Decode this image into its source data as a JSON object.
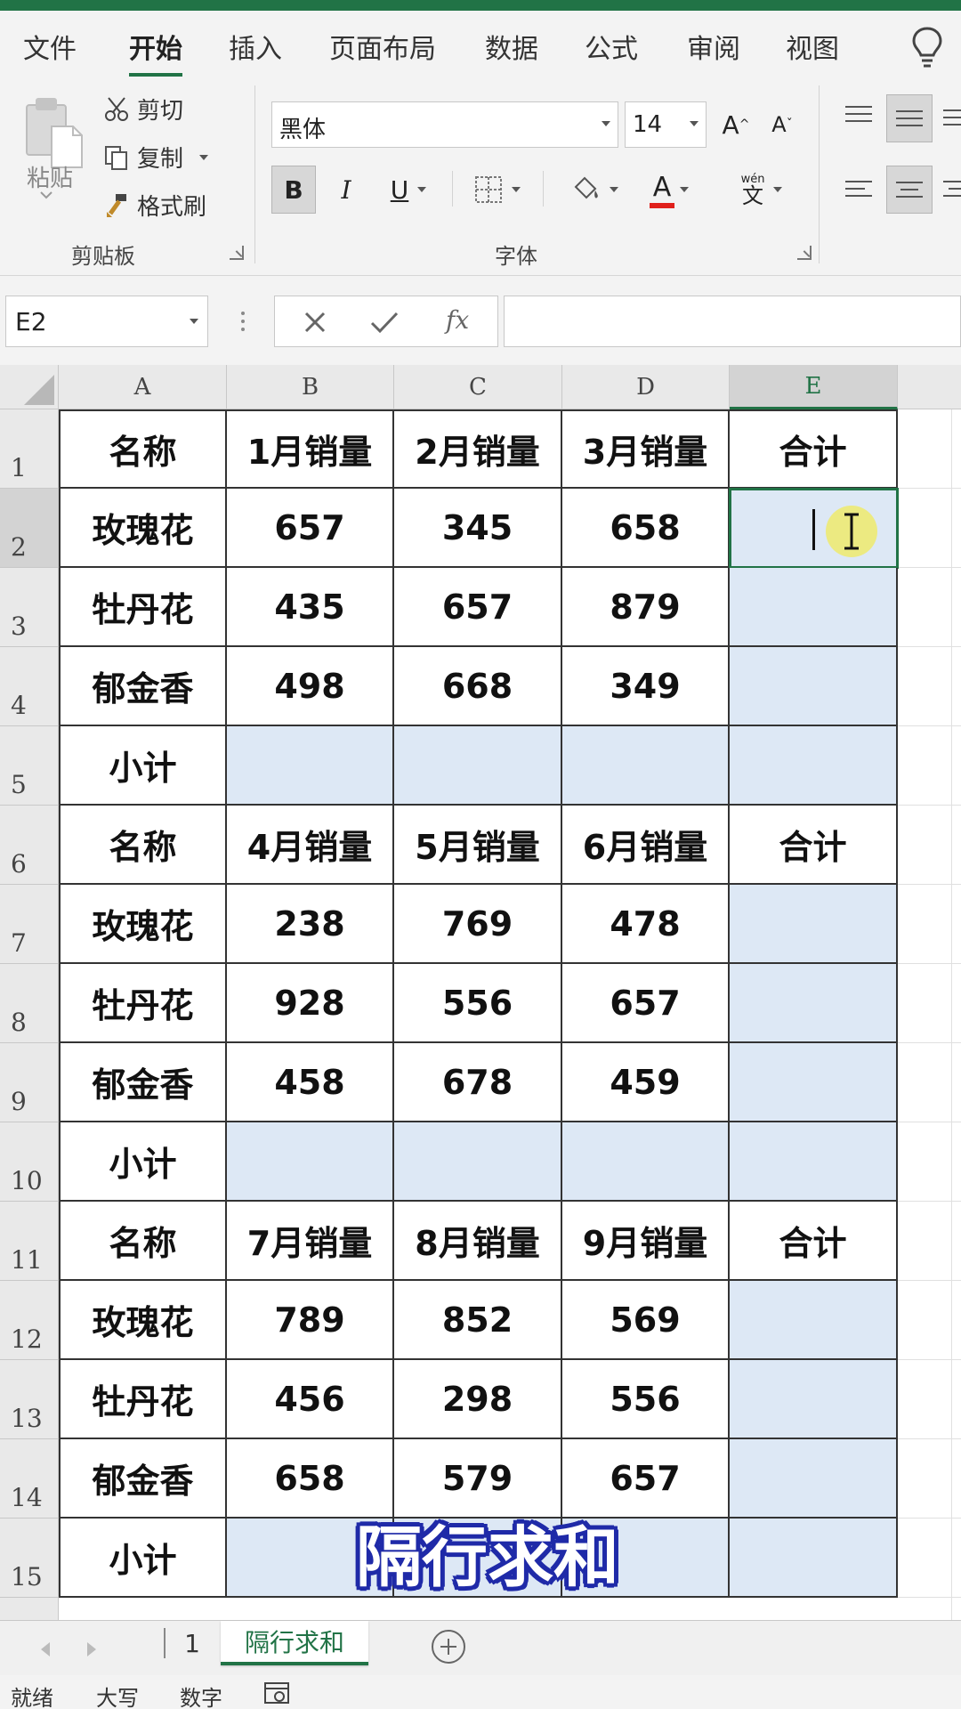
{
  "ribbon_tabs": [
    "文件",
    "开始",
    "插入",
    "页面布局",
    "数据",
    "公式",
    "审阅",
    "视图"
  ],
  "active_tab": "开始",
  "clipboard": {
    "paste_label": "粘贴",
    "cut_label": "剪切",
    "copy_label": "复制",
    "format_painter_label": "格式刷",
    "group_label": "剪贴板"
  },
  "font": {
    "name": "黑体",
    "size": "14",
    "bold": "B",
    "italic": "I",
    "underline": "U",
    "font_color_letter": "A",
    "phonetic_top": "wén",
    "phonetic_char": "文",
    "group_label": "字体",
    "grow_letter": "A",
    "shrink_letter": "A"
  },
  "formula_bar": {
    "name_box": "E2",
    "fx_label": "fx",
    "formula": ""
  },
  "columns": [
    "A",
    "B",
    "C",
    "D",
    "E"
  ],
  "selected_column": "E",
  "selected_row": "2",
  "rows": [
    {
      "num": "1",
      "cells": [
        "名称",
        "1月销量",
        "2月销量",
        "3月销量",
        "合计"
      ],
      "blue": [
        false,
        false,
        false,
        false,
        false
      ]
    },
    {
      "num": "2",
      "cells": [
        "玫瑰花",
        "657",
        "345",
        "658",
        ""
      ],
      "blue": [
        false,
        false,
        false,
        false,
        true
      ]
    },
    {
      "num": "3",
      "cells": [
        "牡丹花",
        "435",
        "657",
        "879",
        ""
      ],
      "blue": [
        false,
        false,
        false,
        false,
        true
      ]
    },
    {
      "num": "4",
      "cells": [
        "郁金香",
        "498",
        "668",
        "349",
        ""
      ],
      "blue": [
        false,
        false,
        false,
        false,
        true
      ]
    },
    {
      "num": "5",
      "cells": [
        "小计",
        "",
        "",
        "",
        ""
      ],
      "blue": [
        false,
        true,
        true,
        true,
        true
      ]
    },
    {
      "num": "6",
      "cells": [
        "名称",
        "4月销量",
        "5月销量",
        "6月销量",
        "合计"
      ],
      "blue": [
        false,
        false,
        false,
        false,
        false
      ]
    },
    {
      "num": "7",
      "cells": [
        "玫瑰花",
        "238",
        "769",
        "478",
        ""
      ],
      "blue": [
        false,
        false,
        false,
        false,
        true
      ]
    },
    {
      "num": "8",
      "cells": [
        "牡丹花",
        "928",
        "556",
        "657",
        ""
      ],
      "blue": [
        false,
        false,
        false,
        false,
        true
      ]
    },
    {
      "num": "9",
      "cells": [
        "郁金香",
        "458",
        "678",
        "459",
        ""
      ],
      "blue": [
        false,
        false,
        false,
        false,
        true
      ]
    },
    {
      "num": "10",
      "cells": [
        "小计",
        "",
        "",
        "",
        ""
      ],
      "blue": [
        false,
        true,
        true,
        true,
        true
      ]
    },
    {
      "num": "11",
      "cells": [
        "名称",
        "7月销量",
        "8月销量",
        "9月销量",
        "合计"
      ],
      "blue": [
        false,
        false,
        false,
        false,
        false
      ]
    },
    {
      "num": "12",
      "cells": [
        "玫瑰花",
        "789",
        "852",
        "569",
        ""
      ],
      "blue": [
        false,
        false,
        false,
        false,
        true
      ]
    },
    {
      "num": "13",
      "cells": [
        "牡丹花",
        "456",
        "298",
        "556",
        ""
      ],
      "blue": [
        false,
        false,
        false,
        false,
        true
      ]
    },
    {
      "num": "14",
      "cells": [
        "郁金香",
        "658",
        "579",
        "657",
        ""
      ],
      "blue": [
        false,
        false,
        false,
        false,
        true
      ]
    },
    {
      "num": "15",
      "cells": [
        "小计",
        "",
        "",
        "",
        ""
      ],
      "blue": [
        false,
        true,
        true,
        true,
        true
      ]
    }
  ],
  "caption": "隔行求和",
  "sheet_tabs": [
    "1",
    "隔行求和"
  ],
  "active_sheet": "隔行求和",
  "status": [
    "就绪",
    "大写",
    "数字"
  ],
  "colors": {
    "accent": "#217346",
    "selection_fill": "#dde8f5",
    "caption_outline": "#1f2aa8",
    "font_color_bar": "#e0201b"
  }
}
